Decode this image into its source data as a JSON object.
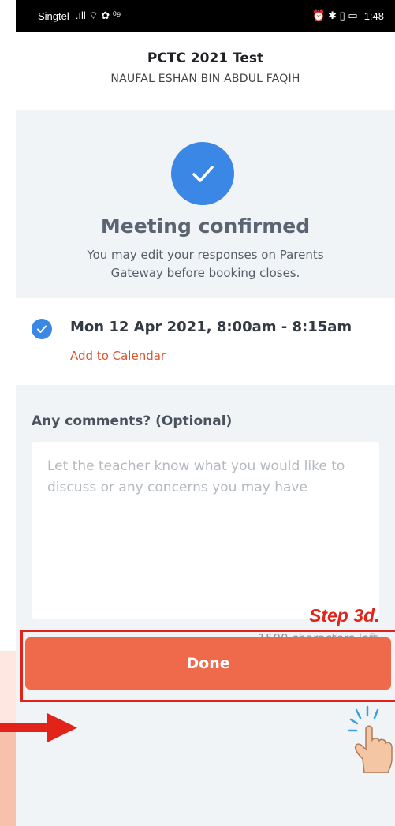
{
  "status_bar": {
    "carrier": "Singtel",
    "left_icons": ".ıll ⌔ ✿ ⁰⁹",
    "right_icons": "⏰ ✱ ▯ ▭",
    "time": "1:48"
  },
  "header": {
    "title": "PCTC 2021 Test",
    "student_name": "NAUFAL ESHAN BIN ABDUL FAQIH"
  },
  "confirmation": {
    "heading": "Meeting confirmed",
    "message": "You may edit your responses on Parents Gateway before booking closes."
  },
  "slot": {
    "time": "Mon 12 Apr 2021, 8:00am - 8:15am",
    "add_to_calendar": "Add to Calendar"
  },
  "comments": {
    "label": "Any comments? (Optional)",
    "placeholder": "Let the teacher know what you would like to discuss or any concerns you may have",
    "value": "",
    "chars_left": "1500 characters left"
  },
  "annotation": {
    "step_label": "Step 3d."
  },
  "actions": {
    "done_label": "Done"
  },
  "colors": {
    "accent_blue": "#3a87e6",
    "primary_orange": "#ef6a4a",
    "link_orange": "#d9562f",
    "annotation_red": "#e2231a",
    "panel_gray": "#f1f4f7"
  }
}
